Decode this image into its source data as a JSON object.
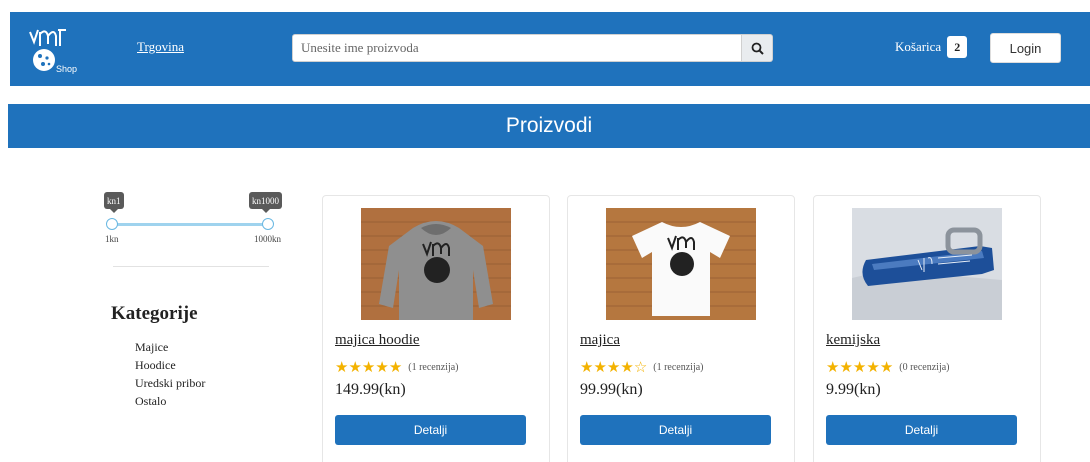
{
  "navbar": {
    "logo_text": "Shop",
    "shop_link": "Trgovina",
    "search_placeholder": "Unesite ime proizvoda",
    "cart_label": "Košarica",
    "cart_count": "2",
    "login_label": "Login",
    "brand_color": "#1f72bc"
  },
  "banner": {
    "title": "Proizvodi"
  },
  "price_filter": {
    "min_tip": "kn1",
    "max_tip": "kn1000",
    "min_label": "1kn",
    "max_label": "1000kn",
    "min_value": 1,
    "max_value": 1000
  },
  "categories": {
    "title": "Kategorije",
    "items": [
      "Majice",
      "Hoodice",
      "Uredski pribor",
      "Ostalo"
    ]
  },
  "products": [
    {
      "name": "majica hoodie",
      "rating": 5,
      "reviews": "(1 recenzija)",
      "price": "149.99(kn)",
      "button": "Detalji",
      "image": "grey-hoodie-photo"
    },
    {
      "name": "majica",
      "rating": 4,
      "reviews": "(1 recenzija)",
      "price": "99.99(kn)",
      "button": "Detalji",
      "image": "white-tshirt-photo"
    },
    {
      "name": "kemijska",
      "rating": 5,
      "reviews": "(0 recenzija)",
      "price": "9.99(kn)",
      "button": "Detalji",
      "image": "blue-pen-photo"
    }
  ]
}
